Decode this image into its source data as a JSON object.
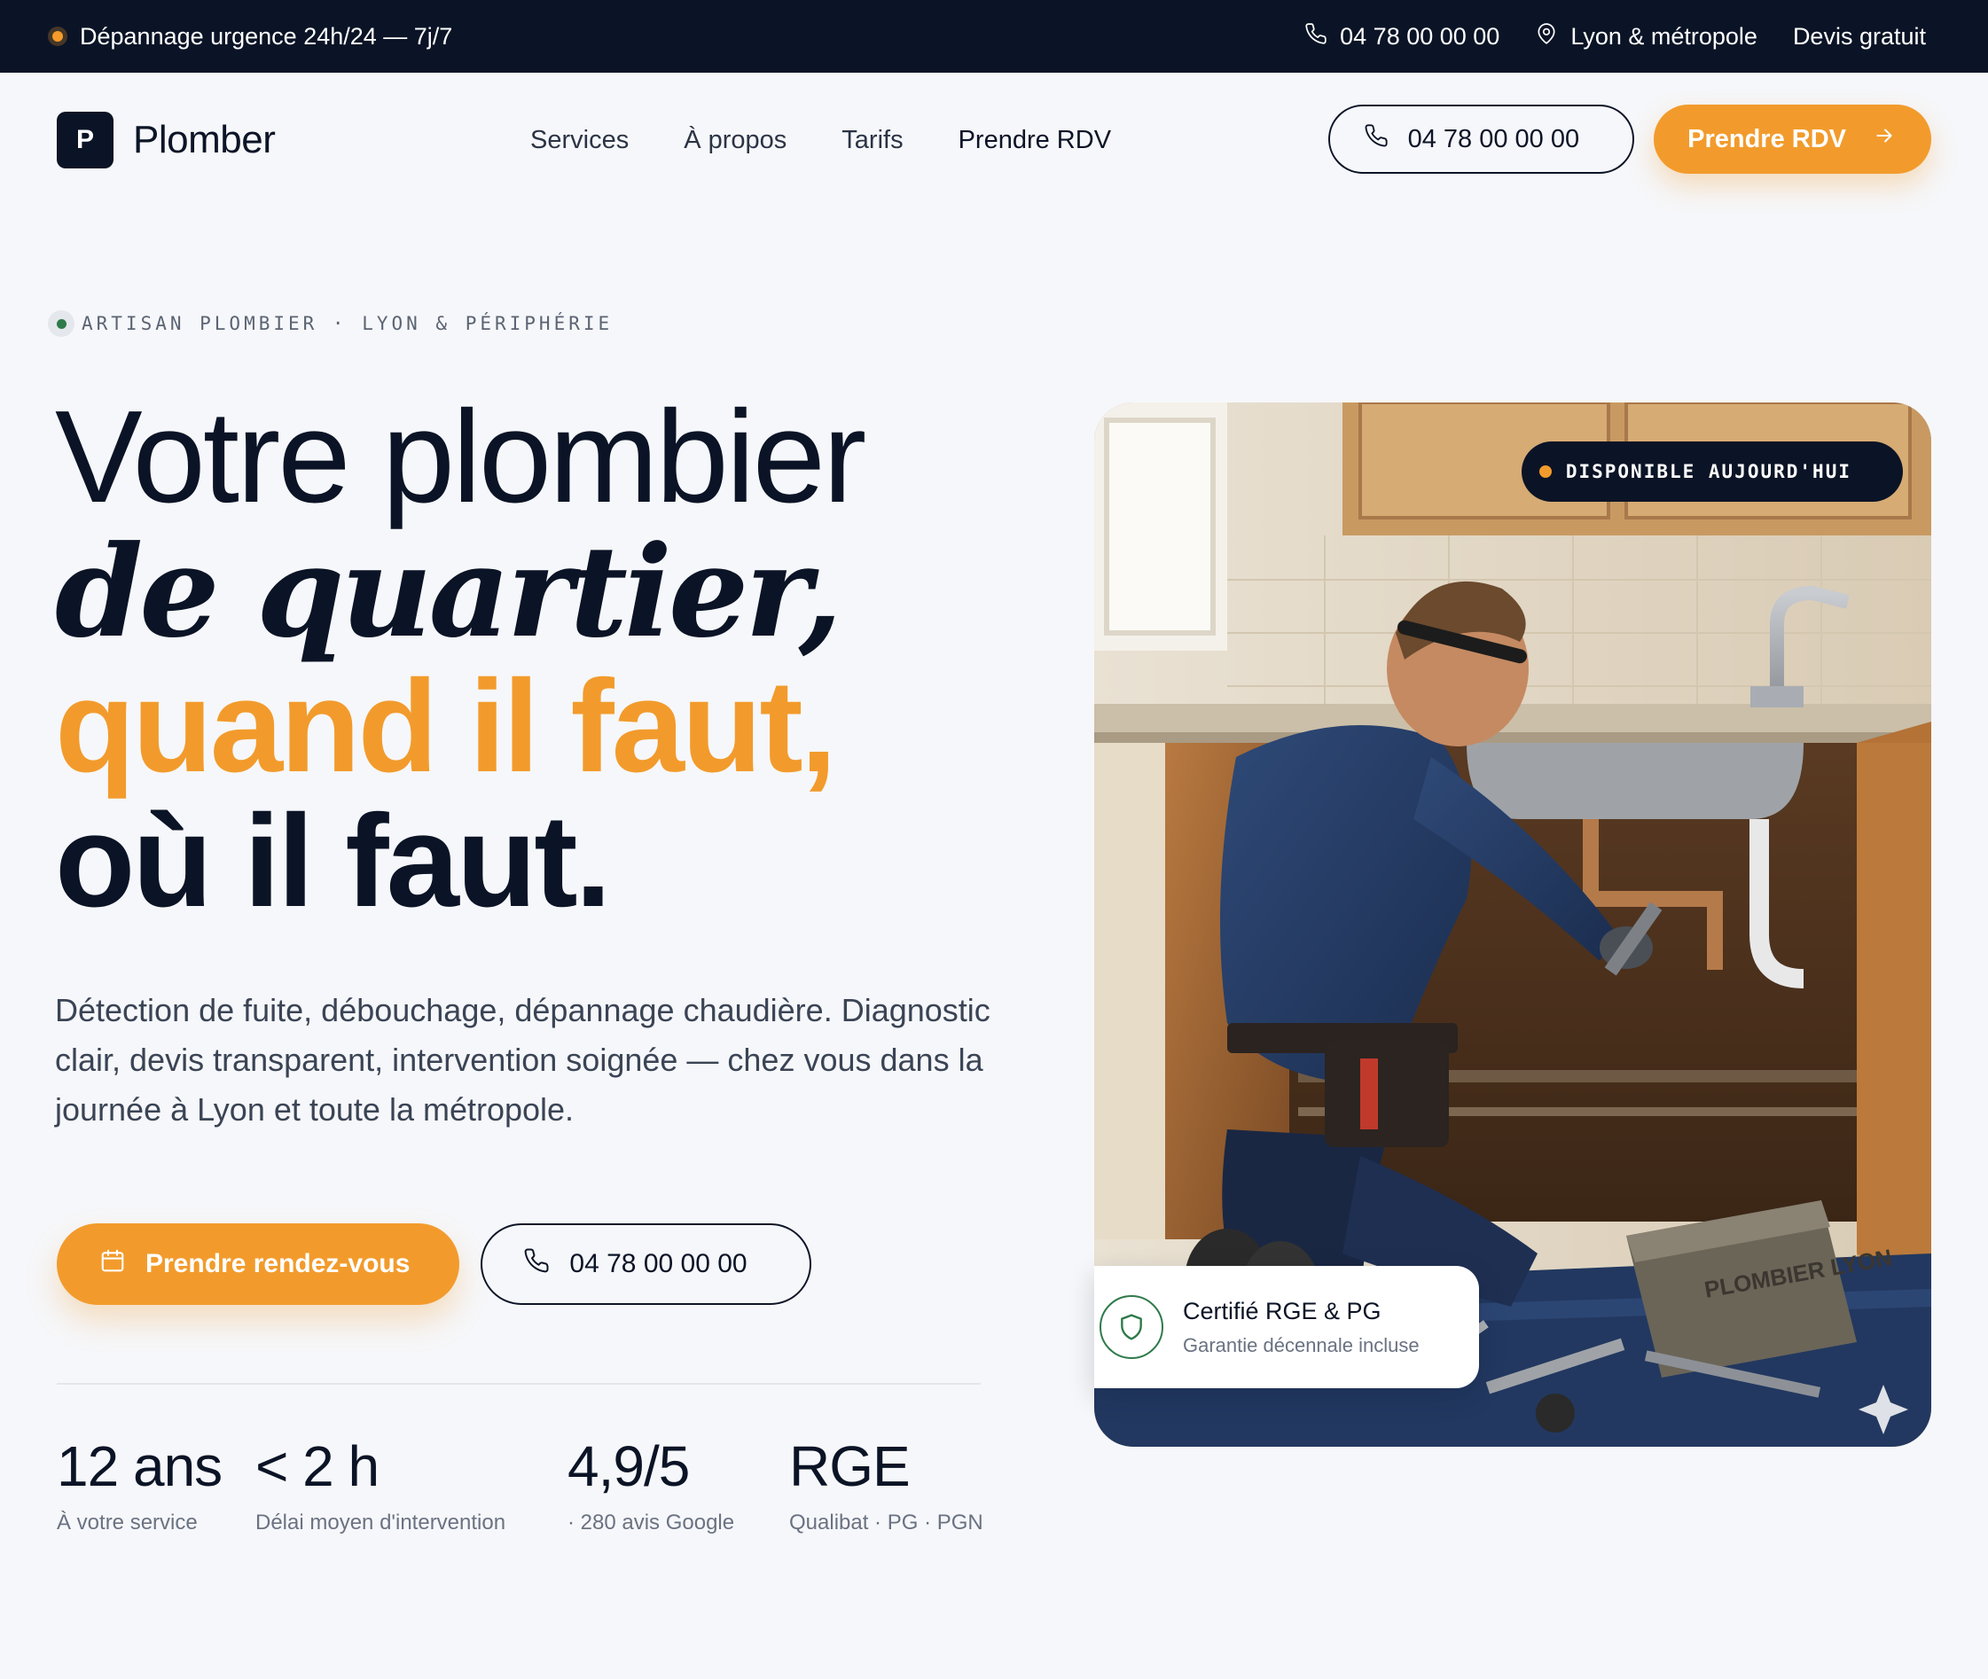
{
  "topbar": {
    "emergency": "Dépannage urgence 24h/24 — 7j/7",
    "phone": "04 78 00 00 00",
    "location": "Lyon & métropole",
    "quote_link": "Devis gratuit"
  },
  "header": {
    "logo_letter": "P",
    "brand": "Plomber",
    "nav": [
      "Services",
      "À propos",
      "Tarifs",
      "Prendre RDV"
    ],
    "phone_button": "04 78 00 00 00",
    "cta_button": "Prendre RDV"
  },
  "hero": {
    "eyebrow": "ARTISAN PLOMBIER · LYON & PÉRIPHÉRIE",
    "headline": {
      "line1": "Votre plombier",
      "line2": "de quartier,",
      "line3": "quand il faut,",
      "line4": "où il faut."
    },
    "lead": "Détection de fuite, débouchage, dépannage chaudière. Diagnostic clair, devis transparent, intervention soignée — chez vous dans la journée à Lyon et toute la métropole.",
    "cta_primary": "Prendre rendez-vous",
    "cta_phone": "04 78 00 00 00",
    "stats": [
      {
        "value": "12 ans",
        "label": "À votre service"
      },
      {
        "value": "< 2 h",
        "label": "Délai moyen d'intervention"
      },
      {
        "value": "4,9/5",
        "label": "· 280 avis Google"
      },
      {
        "value": "RGE",
        "label": "Qualibat · PG · PGN"
      }
    ],
    "photo": {
      "badge": "DISPONIBLE AUJOURD'HUI",
      "toolbox_label": "PLOMBIER LYON"
    },
    "cert": {
      "title": "Certifié RGE & PG",
      "subtitle": "Garantie décennale incluse"
    }
  },
  "colors": {
    "accent": "#f29b2c",
    "navy": "#0b1426",
    "background": "#f6f7fa",
    "success": "#2f7a4a"
  },
  "icons": [
    "phone-icon",
    "map-pin-icon",
    "arrow-right-icon",
    "calendar-icon",
    "shield-icon",
    "sparkle-icon"
  ]
}
